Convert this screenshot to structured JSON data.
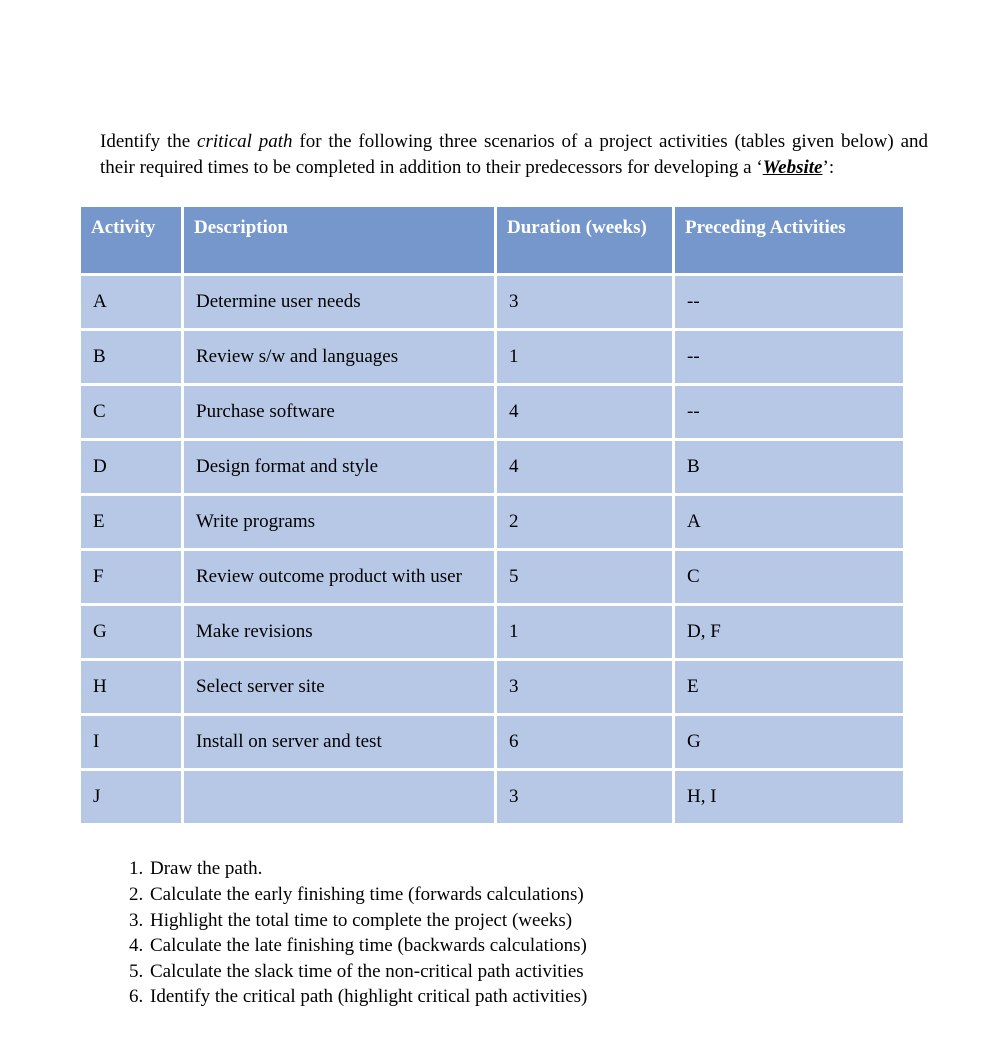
{
  "intro": {
    "part1": "Identify the ",
    "italic": "critical path",
    "part2": " for the following three scenarios of a project activities (tables given below) and their required times to be completed in addition to their predecessors for developing a ‘",
    "bi": "Website",
    "part3": "’:"
  },
  "headers": {
    "activity": "Activity",
    "description": "Description",
    "duration": "Duration (weeks)",
    "preceding": "Preceding Activities"
  },
  "rows": [
    {
      "activity": "A",
      "description": "Determine user needs",
      "duration": "3",
      "preceding": "--"
    },
    {
      "activity": "B",
      "description": "Review s/w and languages",
      "duration": "1",
      "preceding": "--"
    },
    {
      "activity": "C",
      "description": "Purchase software",
      "duration": "4",
      "preceding": "--"
    },
    {
      "activity": "D",
      "description": "Design format and style",
      "duration": "4",
      "preceding": "B"
    },
    {
      "activity": "E",
      "description": "Write programs",
      "duration": "2",
      "preceding": "A"
    },
    {
      "activity": "F",
      "description": "Review outcome product with user",
      "duration": "5",
      "preceding": "C"
    },
    {
      "activity": "G",
      "description": "Make revisions",
      "duration": "1",
      "preceding": "D, F"
    },
    {
      "activity": "H",
      "description": "Select server site",
      "duration": "3",
      "preceding": "E"
    },
    {
      "activity": "I",
      "description": "Install on server and test",
      "duration": "6",
      "preceding": "G"
    },
    {
      "activity": "J",
      "description": "",
      "duration": "3",
      "preceding": "H, I"
    }
  ],
  "tasks": [
    "Draw the path.",
    "Calculate the early finishing time (forwards calculations)",
    "Highlight the total time to complete the project (weeks)",
    "Calculate the late finishing time (backwards calculations)",
    "Calculate the slack time of the non-critical path activities",
    "Identify the critical path (highlight critical path activities)"
  ]
}
